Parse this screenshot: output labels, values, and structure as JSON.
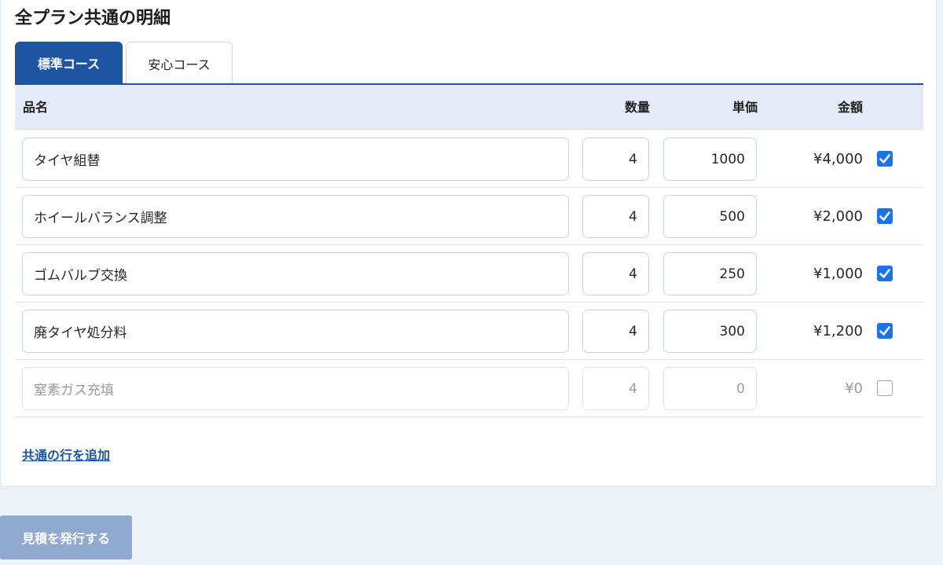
{
  "section": {
    "title": "全プラン共通の明細"
  },
  "tabs": [
    {
      "label": "標準コース",
      "active": true
    },
    {
      "label": "安心コース",
      "active": false
    }
  ],
  "table": {
    "headers": {
      "name": "品名",
      "qty": "数量",
      "price": "単価",
      "amount": "金額"
    },
    "rows": [
      {
        "name": "タイヤ組替",
        "qty": "4",
        "price": "1000",
        "amount": "¥4,000",
        "checked": true
      },
      {
        "name": "ホイールバランス調整",
        "qty": "4",
        "price": "500",
        "amount": "¥2,000",
        "checked": true
      },
      {
        "name": "ゴムバルブ交換",
        "qty": "4",
        "price": "250",
        "amount": "¥1,000",
        "checked": true
      },
      {
        "name": "廃タイヤ処分料",
        "qty": "4",
        "price": "300",
        "amount": "¥1,200",
        "checked": true
      },
      {
        "name": "窒素ガス充填",
        "qty": "4",
        "price": "0",
        "amount": "¥0",
        "checked": false
      }
    ]
  },
  "add_row_label": "共通の行を追加",
  "issue_button_label": "見積を発行する",
  "colors": {
    "accent": "#1d55a3",
    "header_bg": "#e4ebf6",
    "page_bg": "#edf1f8",
    "checkbox": "#1a73e8",
    "button_disabled": "#8fa9cf"
  }
}
